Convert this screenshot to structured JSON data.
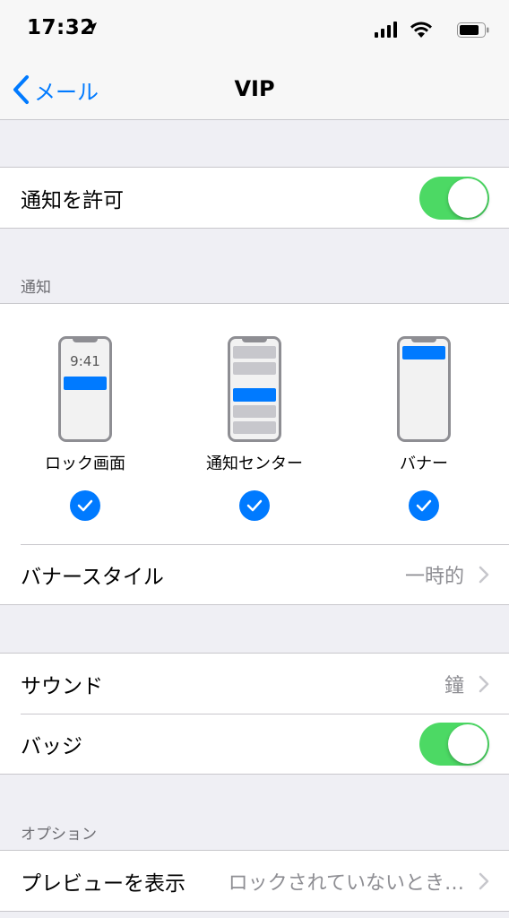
{
  "status_bar": {
    "time": "17:32"
  },
  "nav": {
    "back_label": "メール",
    "title": "VIP"
  },
  "allow_notifications": {
    "label": "通知を許可",
    "enabled": true
  },
  "notifications_section": {
    "header": "通知",
    "lock_screen_time": "9:41",
    "options": [
      {
        "label": "ロック画面",
        "checked": true
      },
      {
        "label": "通知センター",
        "checked": true
      },
      {
        "label": "バナー",
        "checked": true
      }
    ],
    "banner_style": {
      "label": "バナースタイル",
      "value": "一時的"
    }
  },
  "sound": {
    "label": "サウンド",
    "value": "鐘"
  },
  "badge": {
    "label": "バッジ",
    "enabled": true
  },
  "options_section": {
    "header": "オプション",
    "preview": {
      "label": "プレビューを表示",
      "value": "ロックされていないとき…"
    }
  },
  "colors": {
    "accent": "#007aff",
    "toggle_on": "#4cd964",
    "background": "#efeff4"
  }
}
